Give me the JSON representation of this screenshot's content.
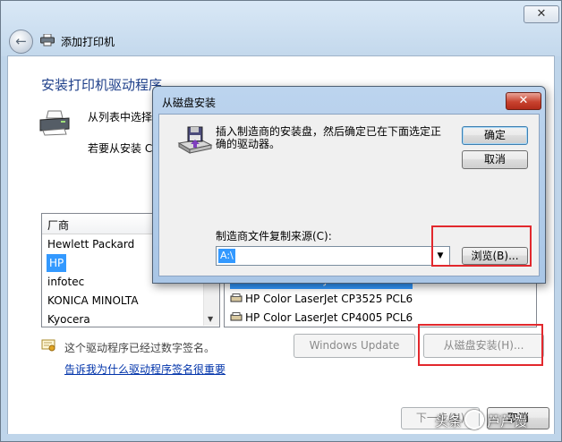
{
  "wizard": {
    "title": "添加打印机",
    "close_label": "✕",
    "heading": "安装打印机驱动程序",
    "desc_line1": "从列表中选择",
    "desc_line2": "若要从安装 C",
    "manufacturer_list": {
      "header": "厂商",
      "items": [
        "Hewlett Packard",
        "HP",
        "infotec",
        "KONICA MINOLTA",
        "Kyocera"
      ],
      "selected": "HP"
    },
    "printer_list": {
      "items": [
        "HP Color LaserJet CP3505 PCL6",
        "HP Color LaserJet CP3525 PCL6",
        "HP Color LaserJet CP4005 PCL6"
      ]
    },
    "signed_text": "这个驱动程序已经过数字签名。",
    "signed_link": "告诉我为什么驱动程序签名很重要",
    "windows_update_label": "Windows Update",
    "have_disk_label": "从磁盘安装(H)...",
    "next_label": "下一步(N)",
    "cancel_label": "取消"
  },
  "dialog": {
    "title": "从磁盘安装",
    "close_label": "✕",
    "message": "插入制造商的安装盘，然后确定已在下面选定正确的驱动器。",
    "ok_label": "确定",
    "cancel_label": "取消",
    "source_label": "制造商文件复制来源(C):",
    "source_value": "A:\\",
    "browse_label": "浏览(B)..."
  },
  "watermark": {
    "left": "头条",
    "right": "芦芦馒"
  },
  "colors": {
    "highlight": "#3399ff",
    "heading": "#1e3f8a",
    "link": "#0033aa",
    "annotation_red": "#e2282d",
    "dialog_close": "#c8422f"
  }
}
